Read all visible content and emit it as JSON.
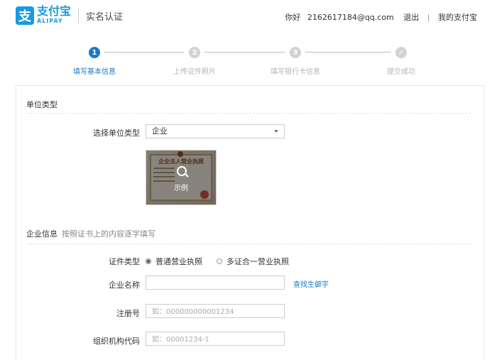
{
  "header": {
    "logo_mark": "支",
    "logo_cn": "支付宝",
    "logo_en": "ALIPAY",
    "page_title": "实名认证",
    "greeting": "你好",
    "account": "2162617184@qq.com",
    "logout": "退出",
    "separator": "|",
    "my_alipay": "我的支付宝"
  },
  "steps": [
    {
      "num": "1",
      "label": "填写基本信息",
      "state": "active"
    },
    {
      "num": "2",
      "label": "上传证件照片",
      "state": "todo"
    },
    {
      "num": "3",
      "label": "填写银行卡信息",
      "state": "todo"
    },
    {
      "num": "✓",
      "label": "提交成功",
      "state": "todo"
    }
  ],
  "unit_section": {
    "title": "单位类型",
    "select_label": "选择单位类型",
    "select_value": "企业",
    "license_heading": "企业法人营业执照",
    "sample_label": "示例"
  },
  "company_section": {
    "title": "企业信息",
    "hint": "按照证书上的内容逐字填写",
    "cert_type_label": "证件类型",
    "cert_options": [
      "普通营业执照",
      "多证合一营业执照"
    ],
    "cert_selected": 0,
    "name_label": "企业名称",
    "name_value": "",
    "rare_char_link": "查找生僻字",
    "reg_label": "注册号",
    "reg_placeholder": "如：000000000001234",
    "org_label": "组织机构代码",
    "org_placeholder": "如：00001234-1"
  },
  "colors": {
    "brand": "#1a9ae0",
    "step_active": "#1a7ac8",
    "step_todo": "#d2d2d2",
    "link": "#1a7ac8"
  }
}
